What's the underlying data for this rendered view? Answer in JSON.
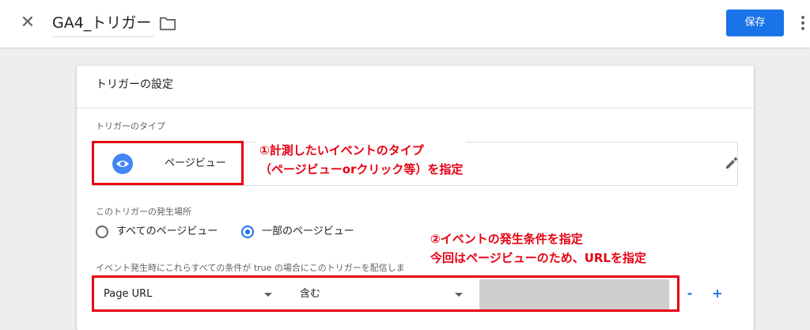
{
  "header": {
    "close_icon": "close-icon",
    "title": "GA4_トリガー",
    "folder_icon": "folder-icon",
    "save_label": "保存",
    "more_icon": "more-vert-icon"
  },
  "card": {
    "title": "トリガーの設定",
    "type_section_label": "トリガーのタイプ",
    "trigger_type": {
      "icon": "eye-icon",
      "label": "ページビュー",
      "edit_icon": "pencil-icon"
    },
    "fire_section_label": "このトリガーの発生場所",
    "fire_options": [
      {
        "label": "すべてのページビュー",
        "selected": false
      },
      {
        "label": "一部のページビュー",
        "selected": true
      }
    ],
    "condition_label": "イベント発生時にこれらすべての条件が true の場合にこのトリガーを配信しま",
    "condition": {
      "variable": "Page URL",
      "operator": "含む",
      "value": "",
      "remove_label": "-",
      "add_label": "+"
    }
  },
  "annotations": {
    "note1_line1": "①計測したいイベントのタイプ",
    "note1_line2": "（ページビューorクリック等）を指定",
    "note2_line1": "②イベントの発生条件を指定",
    "note2_line2": "今回はページビューのため、URLを指定"
  },
  "colors": {
    "accent": "#1a73e8",
    "annotation_red": "#e60012",
    "value_field": "#d0cece"
  }
}
